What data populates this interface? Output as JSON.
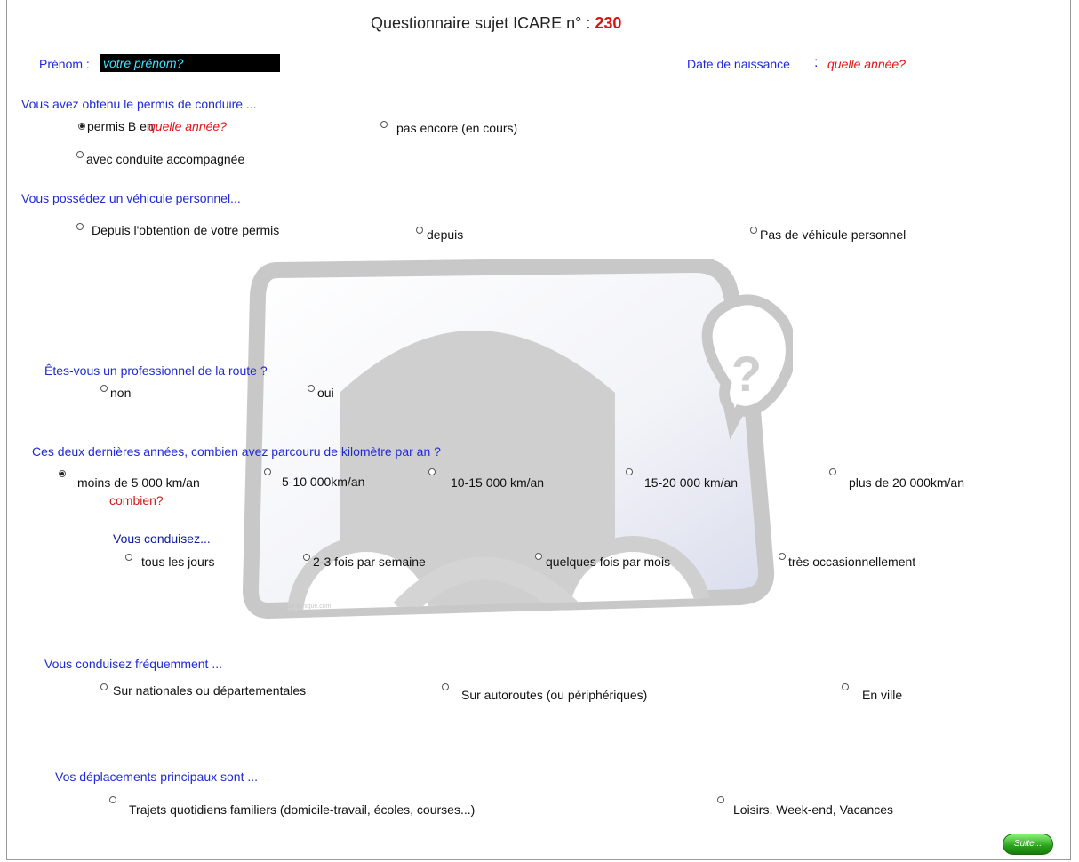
{
  "title": {
    "text": "Questionnaire sujet ICARE n° :",
    "number": "230"
  },
  "identity": {
    "first_name_label": "Prénom :",
    "first_name_value": "votre prénom?",
    "birth_label": "Date de naissance",
    "birth_colon": ":",
    "birth_value": "quelle année?"
  },
  "license": {
    "question": "Vous avez obtenu le permis de conduire ...",
    "opt_b": "permis B en",
    "opt_b_year": "quelle année?",
    "opt_pending": "pas encore (en cours)",
    "opt_accompanied": "avec conduite accompagnée"
  },
  "vehicle": {
    "question": "Vous possédez  un véhicule personnel...",
    "opt_since_license": "Depuis l'obtention de votre permis",
    "opt_since": "depuis",
    "opt_none": "Pas de véhicule personnel"
  },
  "professional": {
    "question": "Êtes-vous un professionnel de la route ?",
    "opt_no": "non",
    "opt_yes": "oui"
  },
  "mileage": {
    "question": "Ces deux dernières années, combien avez parcouru de kilomètre par an ?",
    "options": [
      "moins de 5 000 km/an",
      "5-10 000km/an",
      "10-15 000 km/an",
      "15-20 000 km/an",
      "plus de 20 000km/an"
    ],
    "how_much": "combien?"
  },
  "frequency": {
    "question": "Vous conduisez...",
    "options": [
      "tous les jours",
      "2-3 fois par semaine",
      "quelques fois par mois",
      "très occasionnellement"
    ]
  },
  "roads": {
    "question": "Vous conduisez fréquemment ...",
    "options": [
      "Sur nationales ou départementales",
      "Sur autoroutes (ou périphériques)",
      "En ville"
    ]
  },
  "trips": {
    "question": "Vos déplacements principaux sont ...",
    "options": [
      "Trajets quotidiens familiers (domicile-travail, écoles, courses...)",
      "Loisirs, Week-end, Vacances"
    ]
  },
  "watermark": "www.idgraphique.com",
  "icons": {
    "question_mark_bubble": "?"
  },
  "next_button": "Suite..."
}
